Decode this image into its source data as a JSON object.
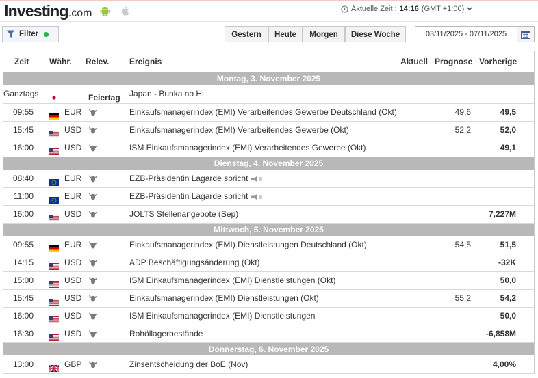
{
  "header": {
    "logo_main": "Investing",
    "logo_suffix": ".com",
    "clock_label": "Aktuelle Zeit :",
    "clock_time": "14:16",
    "clock_tz": "(GMT +1:00)"
  },
  "toolbar": {
    "filter_label": "Filter",
    "buttons": [
      "Gestern",
      "Heute",
      "Morgen",
      "Diese Woche"
    ],
    "date_range": "03/11/2025 - 07/11/2025"
  },
  "columns": {
    "time": "Zeit",
    "currency": "Währ.",
    "importance": "Relev.",
    "event": "Ereignis",
    "actual": "Aktuell",
    "forecast": "Prognose",
    "previous": "Vorherige"
  },
  "days": [
    {
      "label": "Montag, 3. November 2025",
      "events": [
        {
          "time": "Ganztags",
          "flag": "jp",
          "currency": "",
          "importance": "Feiertag",
          "event": "Japan - Bunka no Hi",
          "forecast": "",
          "previous": "",
          "holiday": true
        },
        {
          "time": "09:55",
          "flag": "de",
          "currency": "EUR",
          "importance": 3,
          "event": "Einkaufsmanagerindex (EMI) Verarbeitendes Gewerbe Deutschland (Okt)",
          "forecast": "49,6",
          "previous": "49,5"
        },
        {
          "time": "15:45",
          "flag": "us",
          "currency": "USD",
          "importance": 3,
          "event": "Einkaufsmanagerindex (EMI) Verarbeitendes Gewerbe (Okt)",
          "forecast": "52,2",
          "previous": "52,0"
        },
        {
          "time": "16:00",
          "flag": "us",
          "currency": "USD",
          "importance": 3,
          "event": "ISM Einkaufsmanagerindex (EMI) Verarbeitendes Gewerbe (Okt)",
          "forecast": "",
          "previous": "49,1"
        }
      ]
    },
    {
      "label": "Dienstag, 4. November 2025",
      "events": [
        {
          "time": "08:40",
          "flag": "eu",
          "currency": "EUR",
          "importance": 3,
          "event": "EZB-Präsidentin Lagarde spricht",
          "forecast": "",
          "previous": "",
          "speech": true
        },
        {
          "time": "11:00",
          "flag": "eu",
          "currency": "EUR",
          "importance": 3,
          "event": "EZB-Präsidentin Lagarde spricht",
          "forecast": "",
          "previous": "",
          "speech": true
        },
        {
          "time": "16:00",
          "flag": "us",
          "currency": "USD",
          "importance": 3,
          "event": "JOLTS Stellenangebote (Sep)",
          "forecast": "",
          "previous": "7,227M"
        }
      ]
    },
    {
      "label": "Mittwoch, 5. November 2025",
      "events": [
        {
          "time": "09:55",
          "flag": "de",
          "currency": "EUR",
          "importance": 3,
          "event": "Einkaufsmanagerindex (EMI) Dienstleistungen Deutschland (Okt)",
          "forecast": "54,5",
          "previous": "51,5"
        },
        {
          "time": "14:15",
          "flag": "us",
          "currency": "USD",
          "importance": 3,
          "event": "ADP Beschäftigungsänderung (Okt)",
          "forecast": "",
          "previous": "-32K"
        },
        {
          "time": "15:00",
          "flag": "us",
          "currency": "USD",
          "importance": 3,
          "event": "ISM Einkaufsmanagerindex (EMI) Dienstleistungen (Okt)",
          "forecast": "",
          "previous": "50,0"
        },
        {
          "time": "15:45",
          "flag": "us",
          "currency": "USD",
          "importance": 3,
          "event": "Einkaufsmanagerindex (EMI) Dienstleistungen (Okt)",
          "forecast": "55,2",
          "previous": "54,2"
        },
        {
          "time": "16:00",
          "flag": "us",
          "currency": "USD",
          "importance": 3,
          "event": "ISM Einkaufsmanagerindex (EMI) Dienstleistungen",
          "forecast": "",
          "previous": "50,0"
        },
        {
          "time": "16:30",
          "flag": "us",
          "currency": "USD",
          "importance": 3,
          "event": "Rohöllagerbestände",
          "forecast": "",
          "previous": "-6,858M"
        }
      ]
    },
    {
      "label": "Donnerstag, 6. November 2025",
      "events": [
        {
          "time": "13:00",
          "flag": "gb",
          "currency": "GBP",
          "importance": 3,
          "event": "Zinsentscheidung der BoE (Nov)",
          "forecast": "",
          "previous": "4,00%"
        }
      ]
    }
  ],
  "colors": {
    "day_separator": "#b8b8b8",
    "filter_dot": "#2bb43f"
  }
}
